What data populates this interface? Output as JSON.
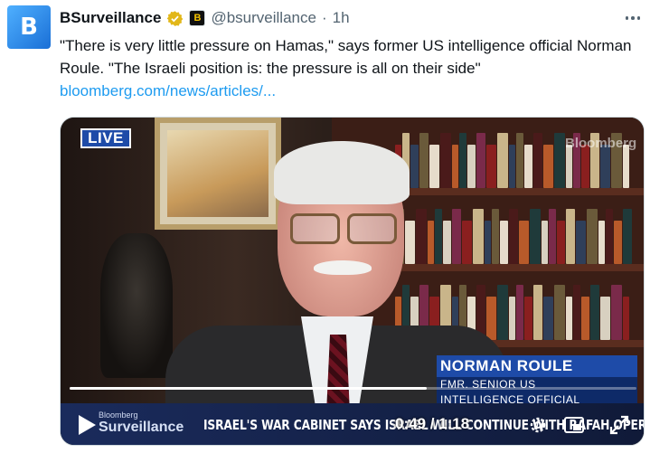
{
  "account": {
    "display_name": "BSurveillance",
    "avatar_letter": "B",
    "affiliate_badge_letter": "B",
    "handle": "@bsurveillance",
    "separator": "·",
    "time": "1h"
  },
  "tweet": {
    "text": "\"There is very little pressure on Hamas,\" says former US intelligence official Norman Roule. \"The Israeli position is: the pressure is all on their side\"",
    "link": "bloomberg.com/news/articles/..."
  },
  "video": {
    "live_label": "LIVE",
    "watermark": "Bloomberg",
    "lower_third": {
      "name": "NORMAN ROULE",
      "title_line1": "FMR. SENIOR US",
      "title_line2": "INTELLIGENCE OFFICIAL"
    },
    "brand_small": "Bloomberg",
    "brand_big": "Surveillance",
    "ticker": "ISRAEL'S WAR CABINET SAYS ISRAEL WILL CONTINUE WITH RAFAH OPERATION",
    "time_readout": "0:49 / 1:18",
    "progress_fraction": 0.63
  },
  "colors": {
    "link": "#1d9bf0",
    "live_badge": "#1e4ba8",
    "verified_gold": "#e2b719"
  }
}
